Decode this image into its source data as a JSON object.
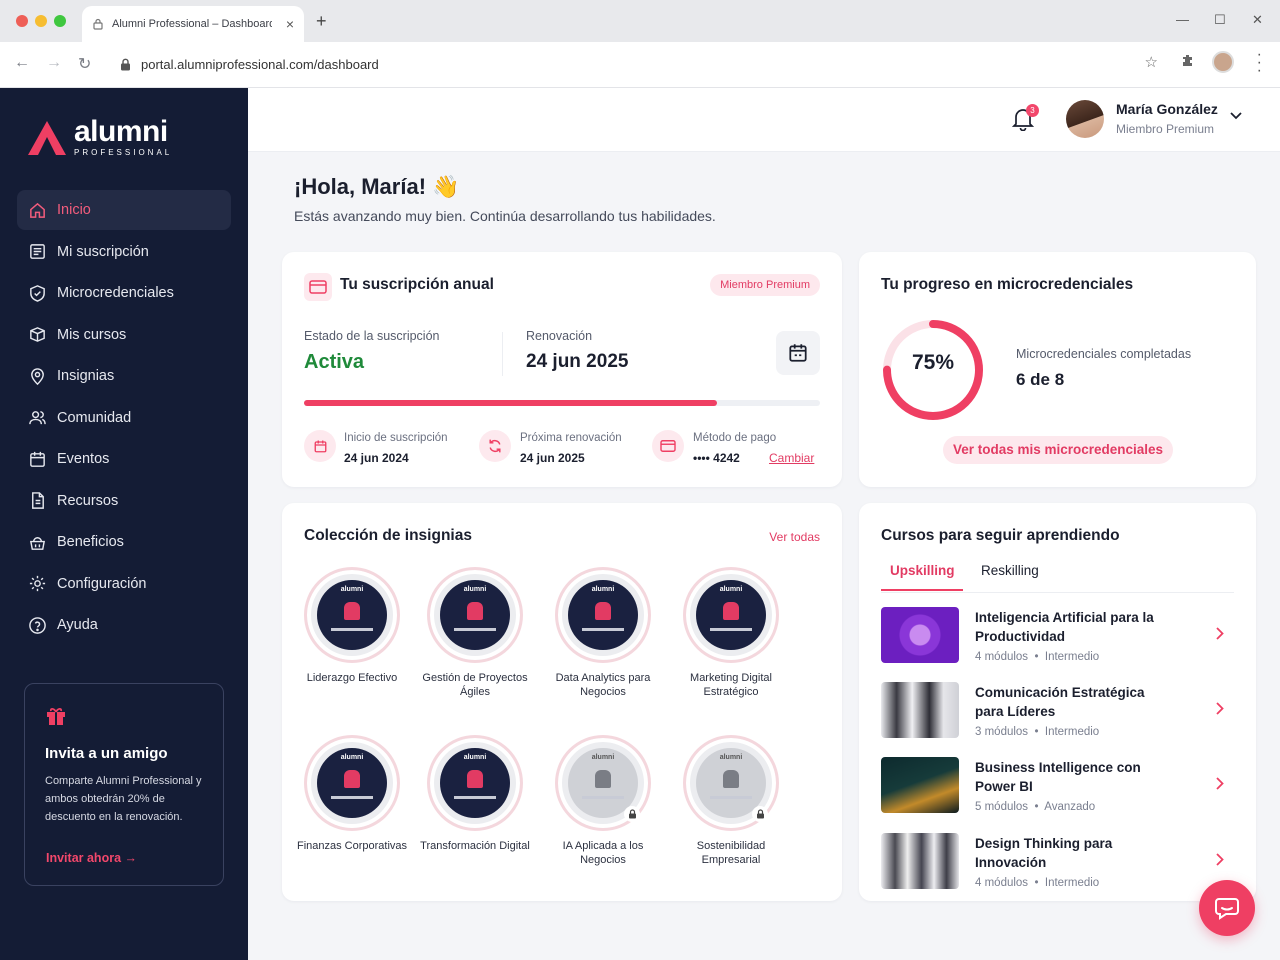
{
  "browser": {
    "tab_title": "Alumni Professional – Dashboard",
    "url": "portal.alumniprofessional.com/dashboard"
  },
  "brand": {
    "name": "alumni",
    "sub": "PROFESSIONAL",
    "accent": "#ef3f63",
    "sidebar_bg": "#141c35"
  },
  "sidebar": {
    "items": [
      {
        "label": "Inicio",
        "icon": "home-icon"
      },
      {
        "label": "Mi suscripción",
        "icon": "subscription-icon"
      },
      {
        "label": "Microcredenciales",
        "icon": "shield-icon"
      },
      {
        "label": "Mis cursos",
        "icon": "box-icon"
      },
      {
        "label": "Insignias",
        "icon": "badge-pin-icon"
      },
      {
        "label": "Comunidad",
        "icon": "users-icon"
      },
      {
        "label": "Eventos",
        "icon": "calendar-icon"
      },
      {
        "label": "Recursos",
        "icon": "document-icon"
      },
      {
        "label": "Beneficios",
        "icon": "gift-basket-icon"
      },
      {
        "label": "Configuración",
        "icon": "gear-icon"
      },
      {
        "label": "Ayuda",
        "icon": "help-icon"
      }
    ],
    "invite": {
      "title": "Invita a un amigo",
      "text": "Comparte Alumni Professional y ambos obtedrán 20% de descuento en la renovación.",
      "link": "Invitar ahora"
    }
  },
  "header": {
    "notifications": "3",
    "user_name": "María González",
    "user_role": "Miembro Premium"
  },
  "greeting": {
    "title": "¡Hola, María! 👋",
    "subtitle": "Estás avanzando muy bien. Continúa desarrollando tus habilidades."
  },
  "subscription": {
    "title": "Tu suscripción anual",
    "badge": "Miembro Premium",
    "status_label": "Estado de la suscripción",
    "status_value": "Activa",
    "renewal_label": "Renovación",
    "renewal_value": "24 jun 2025",
    "progress": 0.8,
    "start_label": "Inicio de suscripción",
    "start_value": "24 jun 2024",
    "next_label": "Próxima renovación",
    "next_value": "24 jun 2025",
    "payment_label": "Método de pago",
    "payment_value": "•••• 4242",
    "payment_change": "Cambiar"
  },
  "progress": {
    "title": "Tu progreso en microcredenciales",
    "percent": "75%",
    "fraction": 0.75,
    "label": "Microcredenciales completadas",
    "value": "6 de 8",
    "button": "Ver todas mis microcredenciales"
  },
  "badges": {
    "title": "Colección de insignias",
    "see_all": "Ver todas",
    "items": [
      {
        "name": "Liderazgo Efectivo",
        "locked": false
      },
      {
        "name": "Gestión de Proyectos Ágiles",
        "locked": false
      },
      {
        "name": "Data Analytics para Negocios",
        "locked": false
      },
      {
        "name": "Marketing Digital Estratégico",
        "locked": false
      },
      {
        "name": "Finanzas Corporativas",
        "locked": false
      },
      {
        "name": "Transformación Digital",
        "locked": false
      },
      {
        "name": "IA Aplicada a los Negocios",
        "locked": true
      },
      {
        "name": "Sostenibilidad Empresarial",
        "locked": true
      }
    ],
    "medal_brand": "alumni"
  },
  "courses": {
    "title": "Cursos para seguir aprendiendo",
    "tabs": [
      "Upskilling",
      "Reskilling"
    ],
    "items": [
      {
        "title": "Inteligencia Artificial para la Productividad",
        "modules": "4 módulos",
        "level": "Intermedio"
      },
      {
        "title": "Comunicación Estratégica para Líderes",
        "modules": "3 módulos",
        "level": "Intermedio"
      },
      {
        "title": "Business Intelligence con Power BI",
        "modules": "5 módulos",
        "level": "Avanzado"
      },
      {
        "title": "Design Thinking para Innovación",
        "modules": "4 módulos",
        "level": "Intermedio"
      }
    ]
  }
}
